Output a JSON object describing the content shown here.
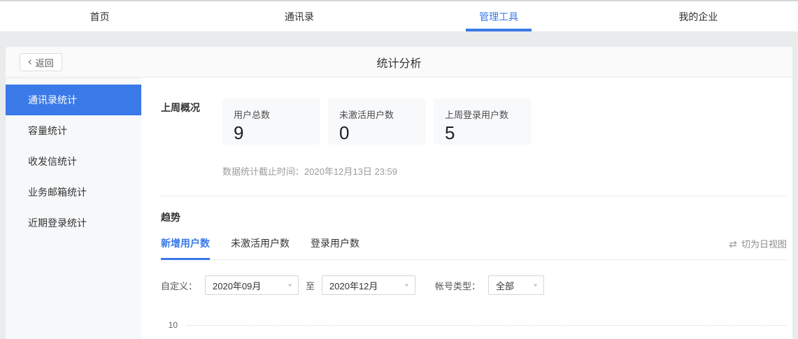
{
  "colors": {
    "accent": "#3a79e8",
    "page_bg": "#eaebec",
    "sidebar_bg": "#f7f8fa",
    "card_bg": "#f8f9fb"
  },
  "nav": {
    "items": [
      {
        "label": "首页"
      },
      {
        "label": "通讯录"
      },
      {
        "label": "管理工具"
      },
      {
        "label": "我的企业"
      }
    ]
  },
  "header": {
    "back_label": "返回",
    "title": "统计分析"
  },
  "icons": {
    "back_chevron": "‹",
    "swap": "⇄",
    "caret": "▼"
  },
  "sidebar": {
    "items": [
      {
        "label": "通讯录统计"
      },
      {
        "label": "容量统计"
      },
      {
        "label": "收发信统计"
      },
      {
        "label": "业务邮箱统计"
      },
      {
        "label": "近期登录统计"
      }
    ]
  },
  "overview": {
    "section_label": "上周概况",
    "cards": [
      {
        "label": "用户总数",
        "value": "9"
      },
      {
        "label": "未激活用户数",
        "value": "0"
      },
      {
        "label": "上周登录用户数",
        "value": "5"
      }
    ],
    "cutoff_label": "数据统计截止时间：",
    "cutoff_value": "2020年12月13日 23:59"
  },
  "trend": {
    "section_label": "趋势",
    "tabs": [
      {
        "label": "新增用户数"
      },
      {
        "label": "未激活用户数"
      },
      {
        "label": "登录用户数"
      }
    ],
    "view_switch_label": "切为日视图",
    "filters": {
      "custom_label": "自定义：",
      "start_month": "2020年09月",
      "to_label": "至",
      "end_month": "2020年12月",
      "account_type_label": "帐号类型：",
      "account_type_value": "全部"
    }
  },
  "chart": {
    "y_tick": "10"
  }
}
